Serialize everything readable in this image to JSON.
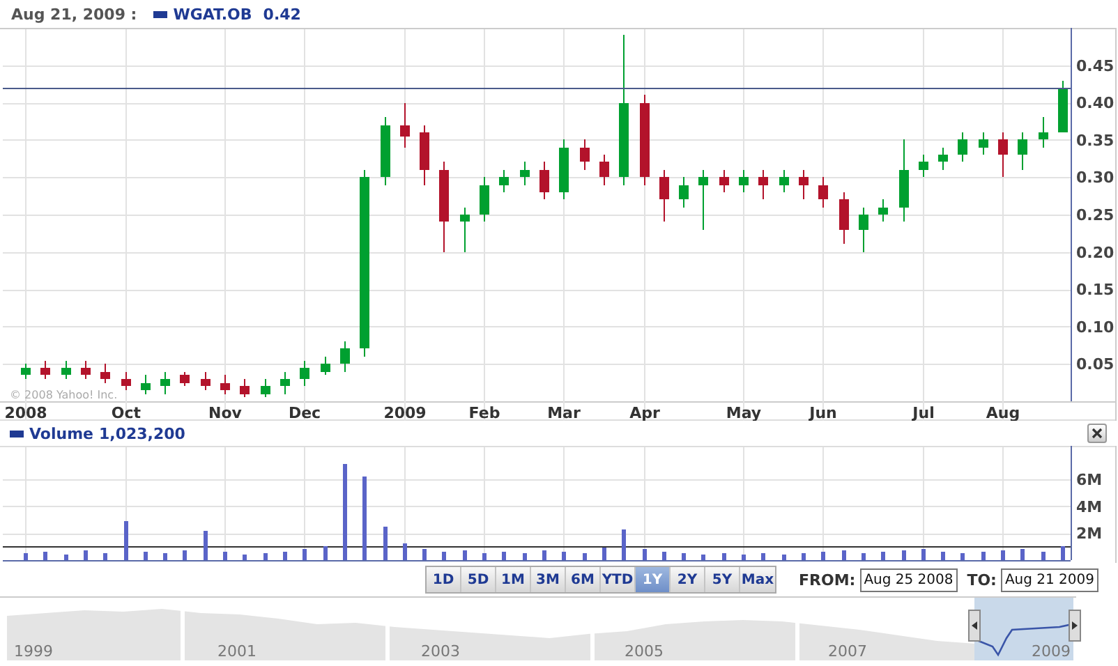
{
  "header": {
    "date": "Aug 21, 2009 :",
    "symbol": "WGAT.OB"
  },
  "price_chart": {
    "copyright": "© 2008 Yahoo! Inc.",
    "chart_data": {
      "type": "candlestick",
      "grid": true,
      "ref_lines": [
        {
          "axis": "y",
          "value": 0.42,
          "label": "0.42"
        }
      ],
      "categories": [
        "2008",
        null,
        null,
        null,
        null,
        "Oct",
        null,
        null,
        null,
        null,
        "Nov",
        null,
        null,
        null,
        "Dec",
        null,
        null,
        null,
        null,
        "2009",
        null,
        null,
        null,
        "Feb",
        null,
        null,
        null,
        "Mar",
        null,
        null,
        null,
        "Apr",
        null,
        null,
        null,
        null,
        "May",
        null,
        null,
        null,
        "Jun",
        null,
        null,
        null,
        null,
        "Jul",
        null,
        null,
        null,
        "Aug",
        null,
        null,
        null
      ],
      "ylim": [
        0,
        0.5
      ],
      "ohlc": [
        [
          0.035,
          0.05,
          0.03,
          0.045
        ],
        [
          0.045,
          0.055,
          0.03,
          0.035
        ],
        [
          0.035,
          0.055,
          0.03,
          0.045
        ],
        [
          0.045,
          0.055,
          0.03,
          0.035
        ],
        [
          0.04,
          0.05,
          0.025,
          0.03
        ],
        [
          0.03,
          0.04,
          0.015,
          0.02
        ],
        [
          0.015,
          0.035,
          0.01,
          0.025
        ],
        [
          0.02,
          0.04,
          0.01,
          0.03
        ],
        [
          0.035,
          0.04,
          0.02,
          0.025
        ],
        [
          0.03,
          0.04,
          0.015,
          0.02
        ],
        [
          0.025,
          0.035,
          0.01,
          0.015
        ],
        [
          0.02,
          0.03,
          0.005,
          0.01
        ],
        [
          0.01,
          0.03,
          0.005,
          0.02
        ],
        [
          0.02,
          0.04,
          0.01,
          0.03
        ],
        [
          0.03,
          0.055,
          0.02,
          0.045
        ],
        [
          0.04,
          0.06,
          0.035,
          0.05
        ],
        [
          0.05,
          0.08,
          0.04,
          0.07
        ],
        [
          0.07,
          0.31,
          0.06,
          0.3
        ],
        [
          0.3,
          0.38,
          0.29,
          0.37
        ],
        [
          0.37,
          0.4,
          0.34,
          0.355
        ],
        [
          0.36,
          0.37,
          0.29,
          0.31
        ],
        [
          0.31,
          0.32,
          0.2,
          0.24
        ],
        [
          0.24,
          0.26,
          0.2,
          0.25
        ],
        [
          0.25,
          0.3,
          0.24,
          0.29
        ],
        [
          0.29,
          0.31,
          0.28,
          0.3
        ],
        [
          0.3,
          0.32,
          0.29,
          0.31
        ],
        [
          0.31,
          0.32,
          0.27,
          0.28
        ],
        [
          0.28,
          0.35,
          0.27,
          0.34
        ],
        [
          0.34,
          0.35,
          0.31,
          0.32
        ],
        [
          0.32,
          0.33,
          0.29,
          0.3
        ],
        [
          0.3,
          0.49,
          0.29,
          0.4
        ],
        [
          0.4,
          0.41,
          0.29,
          0.3
        ],
        [
          0.3,
          0.31,
          0.24,
          0.27
        ],
        [
          0.27,
          0.3,
          0.26,
          0.29
        ],
        [
          0.29,
          0.31,
          0.23,
          0.3
        ],
        [
          0.3,
          0.31,
          0.28,
          0.29
        ],
        [
          0.29,
          0.31,
          0.28,
          0.3
        ],
        [
          0.3,
          0.31,
          0.27,
          0.29
        ],
        [
          0.29,
          0.31,
          0.28,
          0.3
        ],
        [
          0.3,
          0.31,
          0.27,
          0.29
        ],
        [
          0.29,
          0.3,
          0.26,
          0.27
        ],
        [
          0.27,
          0.28,
          0.21,
          0.23
        ],
        [
          0.23,
          0.26,
          0.2,
          0.25
        ],
        [
          0.25,
          0.27,
          0.24,
          0.26
        ],
        [
          0.26,
          0.35,
          0.24,
          0.31
        ],
        [
          0.31,
          0.33,
          0.3,
          0.32
        ],
        [
          0.32,
          0.34,
          0.31,
          0.33
        ],
        [
          0.33,
          0.36,
          0.32,
          0.35
        ],
        [
          0.34,
          0.36,
          0.33,
          0.35
        ],
        [
          0.35,
          0.36,
          0.3,
          0.33
        ],
        [
          0.33,
          0.36,
          0.31,
          0.35
        ],
        [
          0.35,
          0.38,
          0.34,
          0.36
        ],
        [
          0.36,
          0.43,
          0.36,
          0.42
        ]
      ],
      "yticks": [
        {
          "value": 0.05,
          "label": "0.05"
        },
        {
          "value": 0.1,
          "label": "0.10"
        },
        {
          "value": 0.15,
          "label": "0.15"
        },
        {
          "value": 0.2,
          "label": "0.20"
        },
        {
          "value": 0.25,
          "label": "0.25"
        },
        {
          "value": 0.3,
          "label": "0.30"
        },
        {
          "value": 0.35,
          "label": "0.35"
        },
        {
          "value": 0.4,
          "label": "0.40"
        },
        {
          "value": 0.45,
          "label": "0.45"
        }
      ]
    }
  },
  "volume": {
    "chart_data": {
      "type": "bar",
      "grid": true,
      "ref_lines": [
        {
          "axis": "y",
          "value": 1023200,
          "label": "1,023,200"
        }
      ],
      "categories": [
        null,
        null,
        null,
        null,
        null,
        null,
        null,
        null,
        null,
        null,
        null,
        null,
        null,
        null,
        null,
        null,
        null,
        null,
        null,
        null,
        null,
        null,
        null,
        null,
        null,
        null,
        null,
        null,
        null,
        null,
        null,
        null,
        null,
        null,
        null,
        null,
        null,
        null,
        null,
        null,
        null,
        null,
        null,
        null,
        null,
        null,
        null,
        null,
        null,
        null,
        null,
        null,
        null
      ],
      "ylim": [
        0,
        8500000
      ],
      "series": [
        {
          "name": "Volume",
          "color": "#5a64c8",
          "values": [
            500000,
            600000,
            400000,
            700000,
            500000,
            2900000,
            600000,
            500000,
            700000,
            2200000,
            600000,
            400000,
            500000,
            600000,
            800000,
            1000000,
            7200000,
            6200000,
            2500000,
            1200000,
            800000,
            600000,
            700000,
            500000,
            600000,
            500000,
            700000,
            600000,
            500000,
            900000,
            2300000,
            800000,
            600000,
            500000,
            400000,
            500000,
            400000,
            500000,
            400000,
            500000,
            600000,
            700000,
            500000,
            600000,
            700000,
            800000,
            600000,
            500000,
            600000,
            700000,
            800000,
            600000,
            1000000
          ]
        }
      ],
      "yticks": [
        {
          "value": 2000000,
          "label": "2M"
        },
        {
          "value": 4000000,
          "label": "4M"
        },
        {
          "value": 6000000,
          "label": "6M"
        }
      ]
    }
  },
  "ranges": [
    {
      "label": "1D",
      "selected": false
    },
    {
      "label": "5D",
      "selected": false
    },
    {
      "label": "1M",
      "selected": false
    },
    {
      "label": "3M",
      "selected": false
    },
    {
      "label": "6M",
      "selected": false
    },
    {
      "label": "YTD",
      "selected": false
    },
    {
      "label": "1Y",
      "selected": true
    },
    {
      "label": "2Y",
      "selected": false
    },
    {
      "label": "5Y",
      "selected": false
    },
    {
      "label": "Max",
      "selected": false
    }
  ],
  "from": {
    "label": "FROM:",
    "value": "Aug 25 2008"
  },
  "to": {
    "label": "TO:",
    "value": "Aug 21 2009"
  },
  "navigator": {
    "years": [
      "1999",
      "2001",
      "2003",
      "2005",
      "2007",
      "2009"
    ]
  }
}
